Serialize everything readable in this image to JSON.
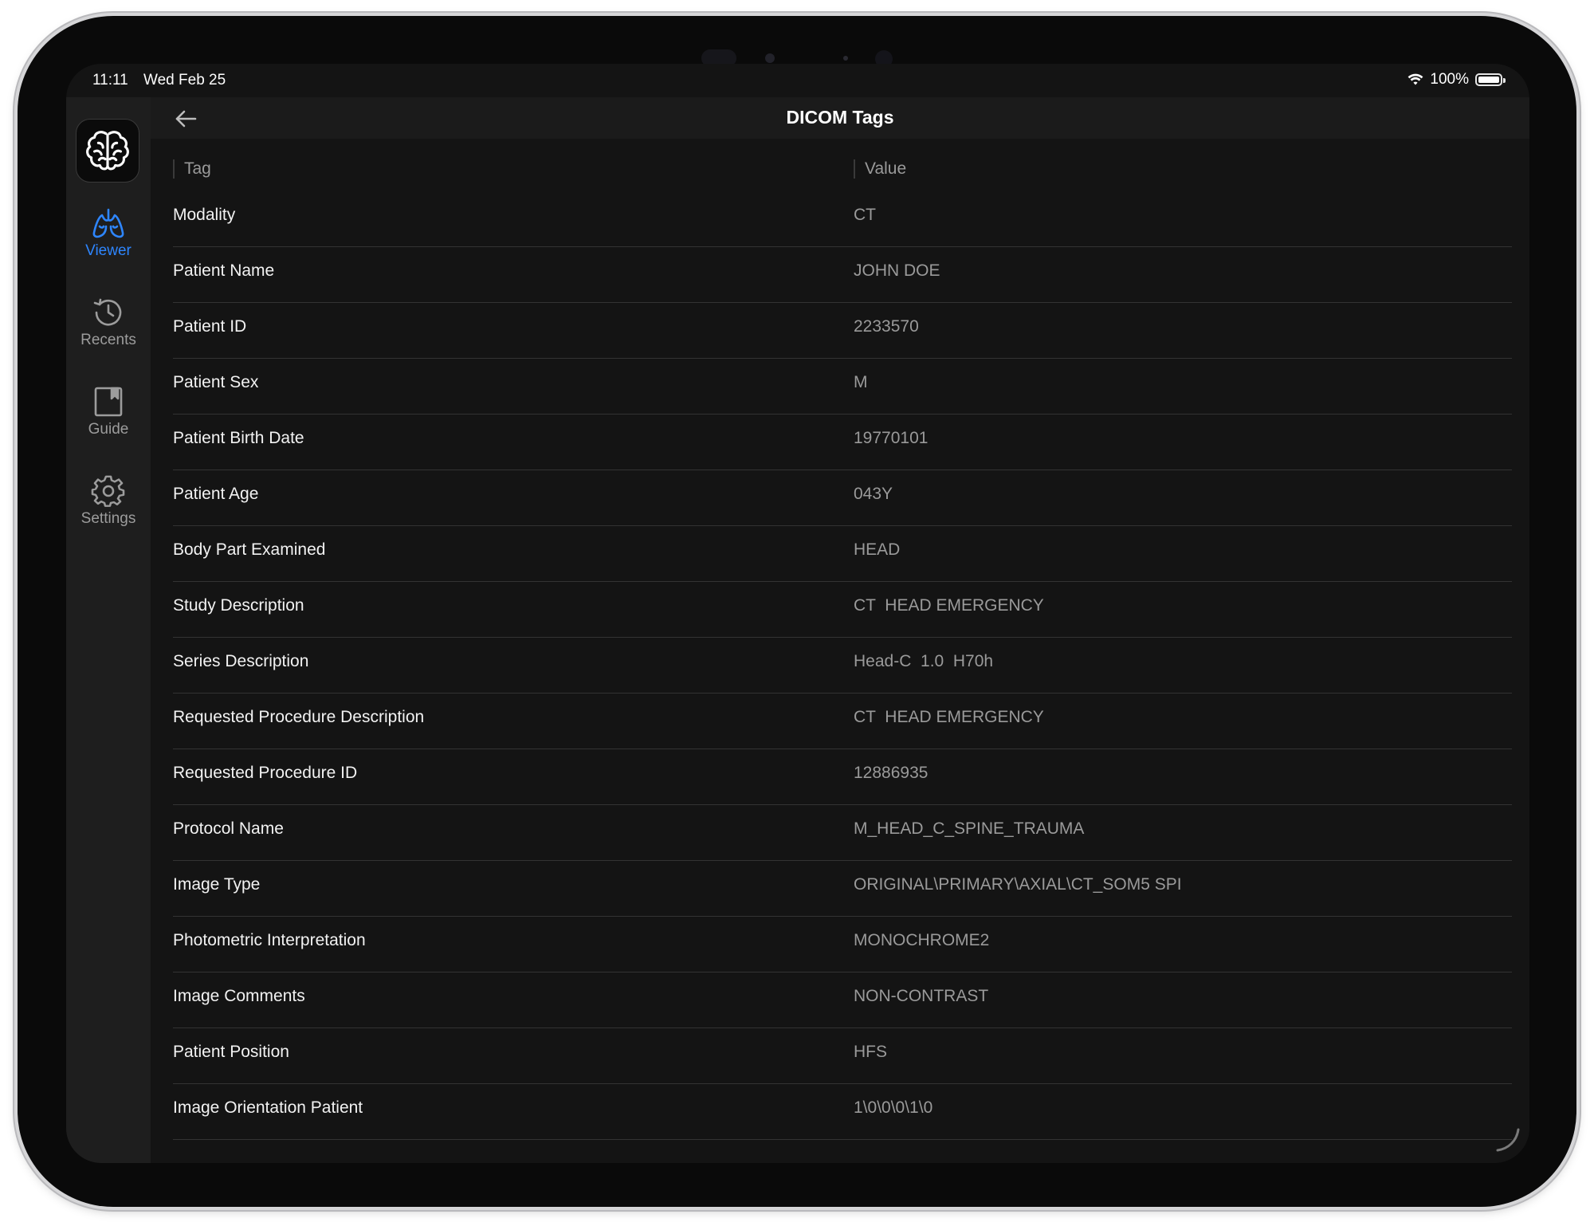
{
  "status_bar": {
    "time": "11:11",
    "date": "Wed Feb 25",
    "battery_percent": "100%",
    "battery_level": 1.0,
    "wifi_icon": "wifi-icon",
    "battery_icon": "battery-icon"
  },
  "sidebar": {
    "app_icon": "brain-icon",
    "items": [
      {
        "label": "Viewer",
        "icon": "lungs-icon",
        "active": true
      },
      {
        "label": "Recents",
        "icon": "clock-history-icon",
        "active": false
      },
      {
        "label": "Guide",
        "icon": "book-icon",
        "active": false
      },
      {
        "label": "Settings",
        "icon": "gear-icon",
        "active": false
      }
    ]
  },
  "navbar": {
    "title": "DICOM Tags",
    "back_icon": "arrow-left-icon"
  },
  "table": {
    "columns": [
      "Tag",
      "Value"
    ],
    "rows": [
      {
        "tag": "Modality",
        "value": "CT"
      },
      {
        "tag": "Patient Name",
        "value": "JOHN DOE"
      },
      {
        "tag": "Patient ID",
        "value": "2233570"
      },
      {
        "tag": "Patient Sex",
        "value": "M"
      },
      {
        "tag": "Patient Birth Date",
        "value": "19770101"
      },
      {
        "tag": "Patient Age",
        "value": "043Y"
      },
      {
        "tag": "Body Part Examined",
        "value": "HEAD"
      },
      {
        "tag": "Study Description",
        "value": "CT  HEAD EMERGENCY"
      },
      {
        "tag": "Series Description",
        "value": "Head-C  1.0  H70h"
      },
      {
        "tag": "Requested Procedure Description",
        "value": "CT  HEAD EMERGENCY"
      },
      {
        "tag": "Requested Procedure ID",
        "value": "12886935"
      },
      {
        "tag": "Protocol Name",
        "value": "M_HEAD_C_SPINE_TRAUMA"
      },
      {
        "tag": "Image Type",
        "value": "ORIGINAL\\PRIMARY\\AXIAL\\CT_SOM5 SPI"
      },
      {
        "tag": "Photometric Interpretation",
        "value": "MONOCHROME2"
      },
      {
        "tag": "Image Comments",
        "value": "NON-CONTRAST"
      },
      {
        "tag": "Patient Position",
        "value": "HFS"
      },
      {
        "tag": "Image Orientation Patient",
        "value": "1\\0\\0\\0\\1\\0"
      }
    ]
  },
  "colors": {
    "accent": "#2e86ff",
    "background": "#141414",
    "sidebar": "#1e1e1e",
    "text_primary": "#f2f2f2",
    "text_secondary": "#9a9a9a"
  }
}
